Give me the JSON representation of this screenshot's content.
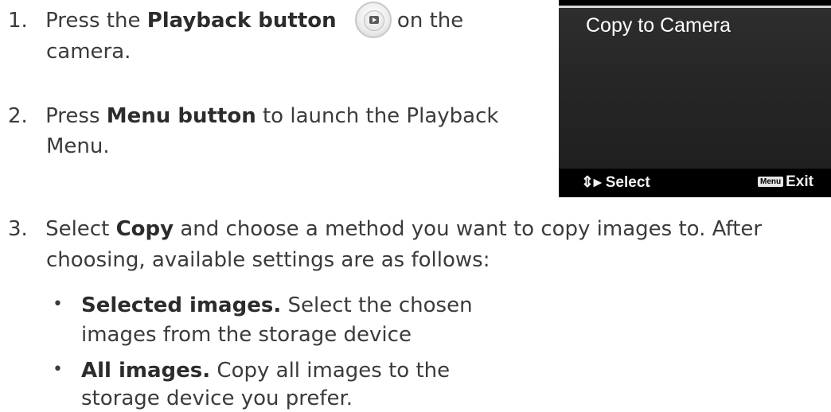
{
  "steps": [
    {
      "number": "1.",
      "pre": "Press the ",
      "bold": "Playback button",
      "post": " on the",
      "cont": "camera."
    },
    {
      "number": "2.",
      "pre": "Press ",
      "bold": "Menu button",
      "post": " to launch the Playback",
      "cont": "Menu."
    },
    {
      "number": "3.",
      "pre": "Select ",
      "bold": "Copy",
      "post": " and choose a method you want to copy images to. After",
      "cont": "choosing, available settings are as follows:"
    }
  ],
  "bullets": [
    {
      "symbol": "•",
      "bold": "Selected images.",
      "text": " Select the chosen",
      "cont": "images from the storage device"
    },
    {
      "symbol": "•",
      "bold": "All images.",
      "text": " Copy all images to the",
      "cont": "storage device you prefer."
    }
  ],
  "icons": {
    "playback": "playback-button-icon",
    "select": "up-down-arrows-icon",
    "menu_key": "menu-key-icon"
  },
  "camera_screen": {
    "menu_item": "Copy to Camera",
    "select_glyph": "⇕▸",
    "select_label": "Select",
    "menu_key_label": "Menu",
    "exit_label": "Exit"
  }
}
